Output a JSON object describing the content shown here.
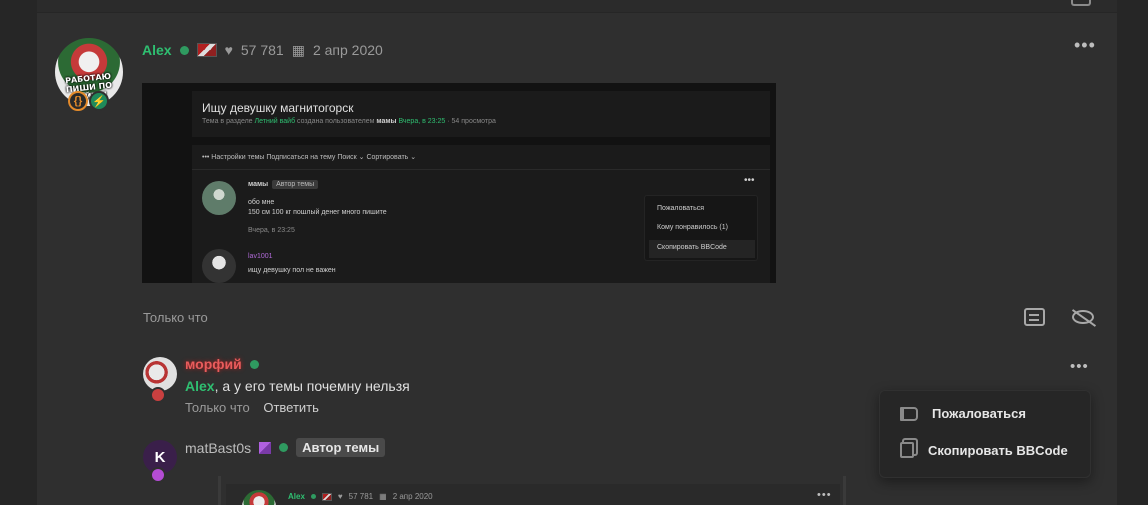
{
  "post": {
    "author": "Alex",
    "likes": "57 781",
    "date": "2 апр 2020",
    "avatar_caption": "РАБОТАЮ ПИШИ ПО ХУЙНЕ!",
    "timestamp": "Только что"
  },
  "embed": {
    "title": "Ищу девушку магнитогорск",
    "subtitle_prefix": "Тема в разделе",
    "subtitle_section": "Летний вайб",
    "subtitle_mid": "создана пользователем",
    "subtitle_user": "мамы",
    "subtitle_time": "Вчера, в 23:25",
    "subtitle_views": "· 54 просмотра",
    "toolbar": "••• Настройки темы   Подписаться на тему   Поиск ⌄    Сортировать ⌄",
    "post1_user": "мамы",
    "post1_tag": "Автор темы",
    "post1_line1": "обо мне",
    "post1_line2": "150 см 100 кг пошлый денег много пишите",
    "post1_time": "Вчера, в 23:25",
    "post2_user": "lav1001",
    "post2_text": "ищу девушку пол не важен",
    "menu_report": "Пожаловаться",
    "menu_likes": "Кому понравилось (1)",
    "menu_copy": "Скопировать BBCode"
  },
  "comments": [
    {
      "author": "морфий",
      "mention": "Alex",
      "text": ", а у его темы почемну нельзя",
      "time": "Только что",
      "reply_label": "Ответить"
    },
    {
      "author": "matBast0s",
      "badge": "Автор темы",
      "avatar_letter": "K"
    }
  ],
  "nested": {
    "author": "Alex",
    "likes": "57 781",
    "date": "2 апр 2020"
  },
  "context_menu": {
    "report": "Пожаловаться",
    "copy_bbcode": "Скопировать BBCode"
  },
  "colors": {
    "accent_green": "#2fbf71",
    "name_red": "#e85c5c",
    "panel_bg": "#2f2f2f",
    "page_bg": "#262626"
  }
}
